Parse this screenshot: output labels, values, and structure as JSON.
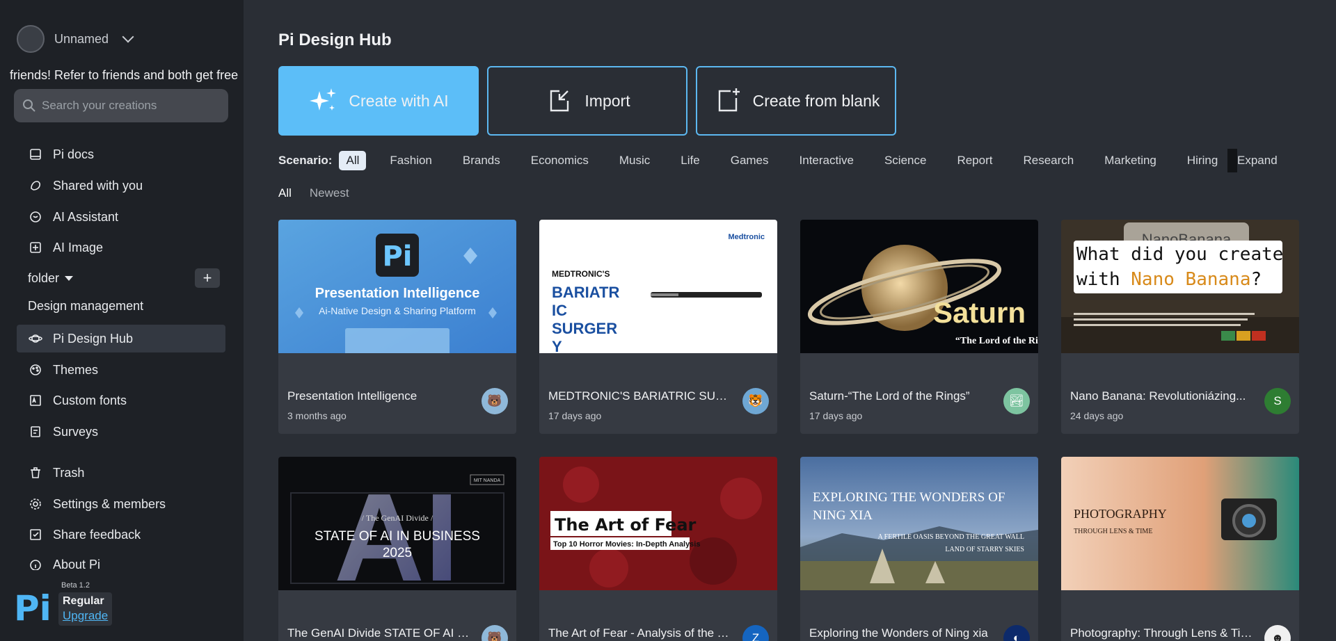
{
  "sidebar": {
    "user_name": "Unnamed",
    "promo": "friends! Refer to friends and both get free",
    "search_placeholder": "Search your creations",
    "nav": [
      {
        "label": "Pi docs",
        "icon": "doc-icon"
      },
      {
        "label": "Shared with you",
        "icon": "share-icon"
      },
      {
        "label": "AI Assistant",
        "icon": "chat-icon"
      },
      {
        "label": "AI Image",
        "icon": "image-icon"
      }
    ],
    "folder_label": "folder",
    "design_label": "Design management",
    "nav2": [
      {
        "label": "Pi Design Hub",
        "icon": "planet-icon"
      },
      {
        "label": "Themes",
        "icon": "palette-icon"
      },
      {
        "label": "Custom fonts",
        "icon": "font-icon"
      },
      {
        "label": "Surveys",
        "icon": "survey-icon"
      },
      {
        "label": "Trash",
        "icon": "trash-icon"
      },
      {
        "label": "Settings & members",
        "icon": "gear-icon"
      },
      {
        "label": "Share feedback",
        "icon": "feedback-icon"
      },
      {
        "label": "About Pi",
        "icon": "info-icon"
      }
    ],
    "footer": {
      "logo": "Pi",
      "beta": "Beta 1.2",
      "plan": "Regular",
      "upgrade": "Upgrade"
    }
  },
  "main": {
    "title": "Pi Design Hub",
    "actions": {
      "create_ai": "Create with AI",
      "import": "Import",
      "blank": "Create from blank"
    },
    "scenario_label": "Scenario:",
    "scenarios": [
      "All",
      "Fashion",
      "Brands",
      "Economics",
      "Music",
      "Life",
      "Games",
      "Interactive",
      "Science",
      "Report",
      "Research",
      "Marketing",
      "Hiring"
    ],
    "expand": "Expand",
    "sort": {
      "all": "All",
      "newest": "Newest"
    },
    "cards": [
      {
        "title": "Presentation Intelligence",
        "time": "3 months ago",
        "thumb": {
          "logo": "Pi",
          "line1": "Presentation Intelligence",
          "line2": "Ai-Native Design & Sharing Platform"
        }
      },
      {
        "title": "MEDTRONIC'S BARIATRIC SURGERY",
        "time": "17 days ago",
        "thumb": {
          "brand": "Medtronic",
          "small": "MEDTRONIC'S",
          "l1": "BARIATR",
          "l2": "IC",
          "l3": "SURGER",
          "l4": "Y"
        }
      },
      {
        "title": "Saturn-“The Lord of the Rings”",
        "time": "17 days ago",
        "thumb": {
          "big": "Saturn",
          "sub": "“The Lord of the Rings”"
        }
      },
      {
        "title": "Nano Banana: Revolutioniázing...",
        "time": "24 days ago",
        "avatar": "S",
        "thumb": {
          "top": "NanoBanana",
          "q1": "What did you create",
          "q2a": "with ",
          "q2b": "Nano Banana",
          "q2c": "?"
        }
      },
      {
        "title": "The GenAI Divide STATE OF AI IN ...",
        "time": "",
        "thumb": {
          "badge": "MIT NANDA",
          "ai": "AI",
          "small": "/ The GenAI Divide /",
          "l1": "STATE OF AI IN BUSINESS",
          "l2": "2025"
        }
      },
      {
        "title": "The Art of Fear - Analysis of the T...",
        "time": "",
        "avatar": "Z",
        "thumb": {
          "l1": "The Art of Fear",
          "l2": "Top 10 Horror Movies: In-Depth Analysis"
        }
      },
      {
        "title": "Exploring the Wonders of Ning xia",
        "time": "",
        "thumb": {
          "l1": "EXPLORING THE WONDERS OF",
          "l2": "NING XIA",
          "s1": "A FERTILE OASIS BEYOND THE GREAT WALL",
          "s2": "LAND OF STARRY SKIES"
        }
      },
      {
        "title": "Photography: Through Lens & Time",
        "time": "",
        "thumb": {
          "l1": "PHOTOGRAPHY",
          "l2": "THROUGH LENS & TIME"
        }
      }
    ]
  }
}
